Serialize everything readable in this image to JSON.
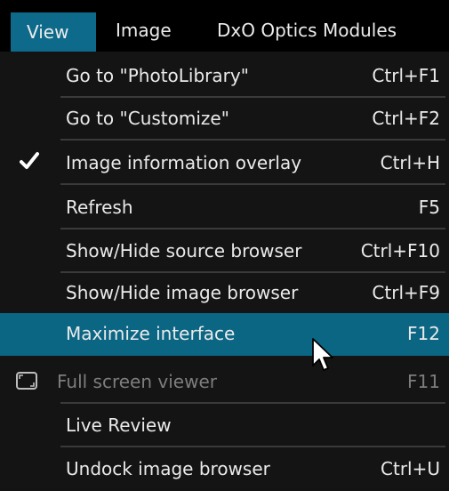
{
  "menubar": {
    "items": [
      "View",
      "Image",
      "DxO Optics Modules"
    ]
  },
  "menu": {
    "items": [
      {
        "label": "Go to \"PhotoLibrary\"",
        "shortcut": "Ctrl+F1"
      },
      {
        "label": "Go to \"Customize\"",
        "shortcut": "Ctrl+F2"
      },
      {
        "label": "Image information overlay",
        "shortcut": "Ctrl+H",
        "checked": true
      },
      {
        "label": "Refresh",
        "shortcut": "F5"
      },
      {
        "label": "Show/Hide source browser",
        "shortcut": "Ctrl+F10"
      },
      {
        "label": "Show/Hide image browser",
        "shortcut": "Ctrl+F9"
      },
      {
        "label": "Maximize interface",
        "shortcut": "F12",
        "highlighted": true
      },
      {
        "label": "Full screen viewer",
        "shortcut": "F11",
        "disabled": true
      },
      {
        "label": "Live Review",
        "shortcut": ""
      },
      {
        "label": "Undock image browser",
        "shortcut": "Ctrl+U"
      }
    ]
  },
  "colors": {
    "highlight": "#0b6684",
    "background": "#141414",
    "disabled_text": "#7d7d7d"
  },
  "icons": {
    "check": "checkmark-icon",
    "full_screen": "full-screen-icon",
    "pointer": "mouse-pointer-icon"
  }
}
